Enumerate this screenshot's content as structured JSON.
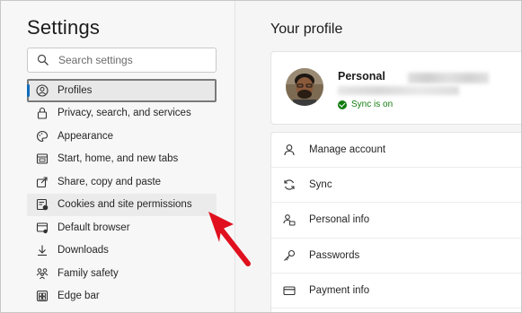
{
  "sidebar": {
    "title": "Settings",
    "search": {
      "placeholder": "Search settings",
      "value": ""
    },
    "items": [
      {
        "label": "Profiles",
        "icon": "profile-icon",
        "selected": true
      },
      {
        "label": "Privacy, search, and services",
        "icon": "lock-icon"
      },
      {
        "label": "Appearance",
        "icon": "palette-icon"
      },
      {
        "label": "Start, home, and new tabs",
        "icon": "home-tab-icon"
      },
      {
        "label": "Share, copy and paste",
        "icon": "share-icon"
      },
      {
        "label": "Cookies and site permissions",
        "icon": "cookie-permissions-icon",
        "hovered": true
      },
      {
        "label": "Default browser",
        "icon": "browser-icon"
      },
      {
        "label": "Downloads",
        "icon": "download-icon"
      },
      {
        "label": "Family safety",
        "icon": "family-icon"
      },
      {
        "label": "Edge bar",
        "icon": "edge-bar-icon"
      }
    ]
  },
  "main": {
    "title": "Your profile",
    "profile": {
      "name": "Personal",
      "sync_status": "Sync is on"
    },
    "menu": [
      {
        "label": "Manage account",
        "icon": "person-icon"
      },
      {
        "label": "Sync",
        "icon": "sync-icon"
      },
      {
        "label": "Personal info",
        "icon": "personal-info-icon"
      },
      {
        "label": "Passwords",
        "icon": "key-icon"
      },
      {
        "label": "Payment info",
        "icon": "card-icon"
      }
    ]
  },
  "colors": {
    "accent": "#0f6cbd",
    "sync_green": "#107c10",
    "annotation_arrow": "#e0101e"
  }
}
